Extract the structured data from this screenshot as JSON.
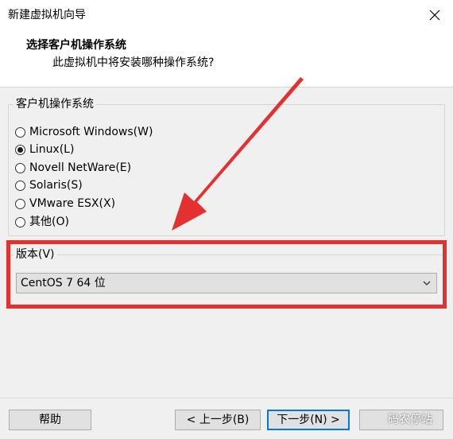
{
  "window": {
    "title": "新建虚拟机向导"
  },
  "header": {
    "title": "选择客户机操作系统",
    "subtitle": "此虚拟机中将安装哪种操作系统?"
  },
  "guest_os": {
    "legend": "客户机操作系统",
    "options": [
      {
        "label": "Microsoft Windows(W)",
        "selected": false
      },
      {
        "label": "Linux(L)",
        "selected": true
      },
      {
        "label": "Novell NetWare(E)",
        "selected": false
      },
      {
        "label": "Solaris(S)",
        "selected": false
      },
      {
        "label": "VMware ESX(X)",
        "selected": false
      },
      {
        "label": "其他(O)",
        "selected": false
      }
    ]
  },
  "version": {
    "legend": "版本(V)",
    "selected": "CentOS 7 64 位"
  },
  "buttons": {
    "help": "帮助",
    "back": "< 上一步(B)",
    "next": "下一步(N) >",
    "cancel": ""
  },
  "watermark": "码农停站",
  "colors": {
    "highlight": "#e53030",
    "accent": "#0078d7",
    "window_bg": "#f0f0f0"
  }
}
